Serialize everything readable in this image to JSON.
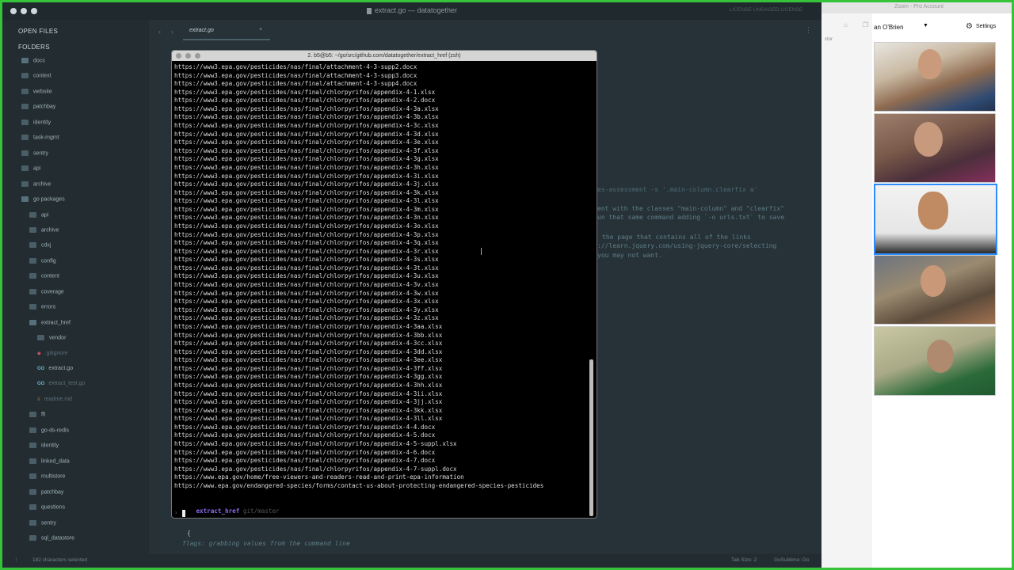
{
  "editor": {
    "title": "extract.go — datatogether",
    "title_right": "LICENSE UNGAGED LICENSE",
    "tab_label": "extract.go",
    "sidebar_open_files": "OPEN FILES",
    "sidebar_folders": "FOLDERS",
    "folders": [
      "docs",
      "context",
      "website",
      "patchbay",
      "identity",
      "task-mgmt",
      "sentry",
      "api",
      "archive",
      "go packages",
      "api",
      "archive",
      "cdxj",
      "config",
      "content",
      "coverage",
      "errors",
      "extract_href",
      "vendor",
      ".gitignore",
      "extract.go",
      "extract_test.go",
      "readme.md",
      "ffi",
      "go-ds-redis",
      "identity",
      "linked_data",
      "multistore",
      "patchbay",
      "questions",
      "sentry",
      "sql_datastore"
    ],
    "status_left": "182 characters selected",
    "status_right_1": "Tab Size: 2",
    "status_right_2": "GoSublime: Go",
    "code_fragments": [
      "es-assessment -s '.main-column.clearfix a'",
      "ent with the classes \"main-column\" and \"clearfix\"",
      "un that same command adding `-o urls.txt` to save",
      "the page that contains all of the links",
      "://learn.jquery.com/using-jquery-core/selecting",
      "you may not want.",
      "{",
      "flags: grabbing values from the command line"
    ]
  },
  "terminal": {
    "title": "2. b5@b5: ~/go/src/github.com/datatogether/extract_href (zsh)",
    "lines": [
      "https://www3.epa.gov/pesticides/nas/final/attachment-4-3-supp2.docx",
      "https://www3.epa.gov/pesticides/nas/final/attachment-4-3-supp3.docx",
      "https://www3.epa.gov/pesticides/nas/final/attachment-4-3-supp4.docx",
      "https://www3.epa.gov/pesticides/nas/final/chlorpyrifos/appendix-4-1.xlsx",
      "https://www3.epa.gov/pesticides/nas/final/chlorpyrifos/appendix-4-2.docx",
      "https://www3.epa.gov/pesticides/nas/final/chlorpyrifos/appendix-4-3a.xlsx",
      "https://www3.epa.gov/pesticides/nas/final/chlorpyrifos/appendix-4-3b.xlsx",
      "https://www3.epa.gov/pesticides/nas/final/chlorpyrifos/appendix-4-3c.xlsx",
      "https://www3.epa.gov/pesticides/nas/final/chlorpyrifos/appendix-4-3d.xlsx",
      "https://www3.epa.gov/pesticides/nas/final/chlorpyrifos/appendix-4-3e.xlsx",
      "https://www3.epa.gov/pesticides/nas/final/chlorpyrifos/appendix-4-3f.xlsx",
      "https://www3.epa.gov/pesticides/nas/final/chlorpyrifos/appendix-4-3g.xlsx",
      "https://www3.epa.gov/pesticides/nas/final/chlorpyrifos/appendix-4-3h.xlsx",
      "https://www3.epa.gov/pesticides/nas/final/chlorpyrifos/appendix-4-3i.xlsx",
      "https://www3.epa.gov/pesticides/nas/final/chlorpyrifos/appendix-4-3j.xlsx",
      "https://www3.epa.gov/pesticides/nas/final/chlorpyrifos/appendix-4-3k.xlsx",
      "https://www3.epa.gov/pesticides/nas/final/chlorpyrifos/appendix-4-3l.xlsx",
      "https://www3.epa.gov/pesticides/nas/final/chlorpyrifos/appendix-4-3m.xlsx",
      "https://www3.epa.gov/pesticides/nas/final/chlorpyrifos/appendix-4-3n.xlsx",
      "https://www3.epa.gov/pesticides/nas/final/chlorpyrifos/appendix-4-3o.xlsx",
      "https://www3.epa.gov/pesticides/nas/final/chlorpyrifos/appendix-4-3p.xlsx",
      "https://www3.epa.gov/pesticides/nas/final/chlorpyrifos/appendix-4-3q.xlsx",
      "https://www3.epa.gov/pesticides/nas/final/chlorpyrifos/appendix-4-3r.xlsx",
      "https://www3.epa.gov/pesticides/nas/final/chlorpyrifos/appendix-4-3s.xlsx",
      "https://www3.epa.gov/pesticides/nas/final/chlorpyrifos/appendix-4-3t.xlsx",
      "https://www3.epa.gov/pesticides/nas/final/chlorpyrifos/appendix-4-3u.xlsx",
      "https://www3.epa.gov/pesticides/nas/final/chlorpyrifos/appendix-4-3v.xlsx",
      "https://www3.epa.gov/pesticides/nas/final/chlorpyrifos/appendix-4-3w.xlsx",
      "https://www3.epa.gov/pesticides/nas/final/chlorpyrifos/appendix-4-3x.xlsx",
      "https://www3.epa.gov/pesticides/nas/final/chlorpyrifos/appendix-4-3y.xlsx",
      "https://www3.epa.gov/pesticides/nas/final/chlorpyrifos/appendix-4-3z.xlsx",
      "https://www3.epa.gov/pesticides/nas/final/chlorpyrifos/appendix-4-3aa.xlsx",
      "https://www3.epa.gov/pesticides/nas/final/chlorpyrifos/appendix-4-3bb.xlsx",
      "https://www3.epa.gov/pesticides/nas/final/chlorpyrifos/appendix-4-3cc.xlsx",
      "https://www3.epa.gov/pesticides/nas/final/chlorpyrifos/appendix-4-3dd.xlsx",
      "https://www3.epa.gov/pesticides/nas/final/chlorpyrifos/appendix-4-3ee.xlsx",
      "https://www3.epa.gov/pesticides/nas/final/chlorpyrifos/appendix-4-3ff.xlsx",
      "https://www3.epa.gov/pesticides/nas/final/chlorpyrifos/appendix-4-3gg.xlsx",
      "https://www3.epa.gov/pesticides/nas/final/chlorpyrifos/appendix-4-3hh.xlsx",
      "https://www3.epa.gov/pesticides/nas/final/chlorpyrifos/appendix-4-3ii.xlsx",
      "https://www3.epa.gov/pesticides/nas/final/chlorpyrifos/appendix-4-3jj.xlsx",
      "https://www3.epa.gov/pesticides/nas/final/chlorpyrifos/appendix-4-3kk.xlsx",
      "https://www3.epa.gov/pesticides/nas/final/chlorpyrifos/appendix-4-3ll.xlsx",
      "https://www3.epa.gov/pesticides/nas/final/chlorpyrifos/appendix-4-4.docx",
      "https://www3.epa.gov/pesticides/nas/final/chlorpyrifos/appendix-4-5.docx",
      "https://www3.epa.gov/pesticides/nas/final/chlorpyrifos/appendix-4-5-suppl.xlsx",
      "https://www3.epa.gov/pesticides/nas/final/chlorpyrifos/appendix-4-6.docx",
      "https://www3.epa.gov/pesticides/nas/final/chlorpyrifos/appendix-4-7.docx",
      "https://www3.epa.gov/pesticides/nas/final/chlorpyrifos/appendix-4-7-suppl.docx",
      "https://www.epa.gov/home/free-viewers-and-readers-read-and-print-epa-information",
      "https://www.epa.gov/endangered-species/forms/contact-us-about-protecting-endangered-species-pesticides"
    ],
    "prompt_dir": "extract_href",
    "prompt_branch": "git/master",
    "prompt_symbol": "›"
  },
  "zoom": {
    "window_title": "Zoom - Pro Account",
    "participant_name": "an O'Brien",
    "settings_label": "Settings",
    "sidebar_fragment": "ctor",
    "colors": {
      "active_speaker": "#2d8cff",
      "terminal_prompt": "#8f6ef0"
    }
  }
}
